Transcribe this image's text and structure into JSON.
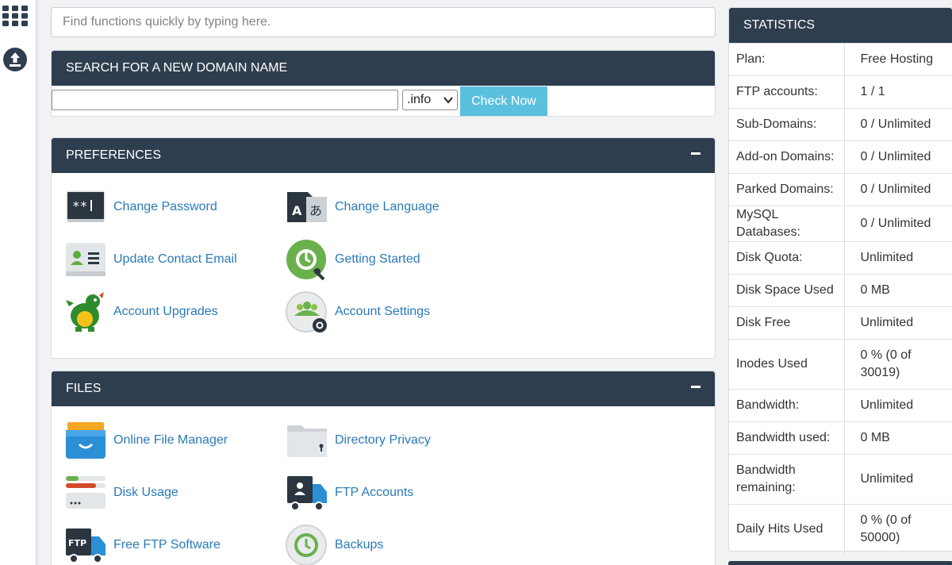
{
  "rail": {
    "icons": [
      "grid-icon",
      "upload-icon"
    ]
  },
  "search": {
    "placeholder": "Find functions quickly by typing here."
  },
  "domain": {
    "title": "SEARCH FOR A NEW DOMAIN NAME",
    "input_value": "",
    "tld_selected": ".info",
    "button_label": "Check Now"
  },
  "preferences": {
    "title": "PREFERENCES",
    "items": [
      {
        "label": "Change Password",
        "icon": "password-icon"
      },
      {
        "label": "Change Language",
        "icon": "language-icon"
      },
      {
        "label": "Update Contact Email",
        "icon": "contact-card-icon"
      },
      {
        "label": "Getting Started",
        "icon": "getting-started-icon"
      },
      {
        "label": "Account Upgrades",
        "icon": "dragon-icon"
      },
      {
        "label": "Account Settings",
        "icon": "users-gear-icon"
      }
    ]
  },
  "files": {
    "title": "FILES",
    "items": [
      {
        "label": "Online File Manager",
        "icon": "file-drawer-icon"
      },
      {
        "label": "Directory Privacy",
        "icon": "locked-folder-icon"
      },
      {
        "label": "Disk Usage",
        "icon": "disk-usage-icon"
      },
      {
        "label": "FTP Accounts",
        "icon": "ftp-truck-user-icon"
      },
      {
        "label": "Free FTP Software",
        "icon": "ftp-truck-icon"
      },
      {
        "label": "Backups",
        "icon": "backup-clock-icon"
      }
    ]
  },
  "statistics": {
    "title": "STATISTICS",
    "rows": [
      {
        "label": "Plan:",
        "value": "Free Hosting"
      },
      {
        "label": "FTP accounts:",
        "value": "1 / 1"
      },
      {
        "label": "Sub-Domains:",
        "value": "0 / Unlimited"
      },
      {
        "label": "Add-on Domains:",
        "value": "0 / Unlimited"
      },
      {
        "label": "Parked Domains:",
        "value": "0 / Unlimited"
      },
      {
        "label": "MySQL Databases:",
        "value": "0 / Unlimited"
      },
      {
        "label": "Disk Quota:",
        "value": "Unlimited"
      },
      {
        "label": "Disk Space Used",
        "value": "0 MB"
      },
      {
        "label": "Disk Free",
        "value": "Unlimited"
      },
      {
        "label": "Inodes Used",
        "value": "0 % (0 of 30019)"
      },
      {
        "label": "Bandwidth:",
        "value": "Unlimited"
      },
      {
        "label": "Bandwidth used:",
        "value": "0 MB"
      },
      {
        "label": "Bandwidth remaining:",
        "value": "Unlimited"
      },
      {
        "label": "Daily Hits Used",
        "value": "0 % (0 of 50000)"
      }
    ]
  },
  "colors": {
    "header_bg": "#2f3e4e",
    "link": "#2a7ab8",
    "check_button": "#5bc0de"
  }
}
